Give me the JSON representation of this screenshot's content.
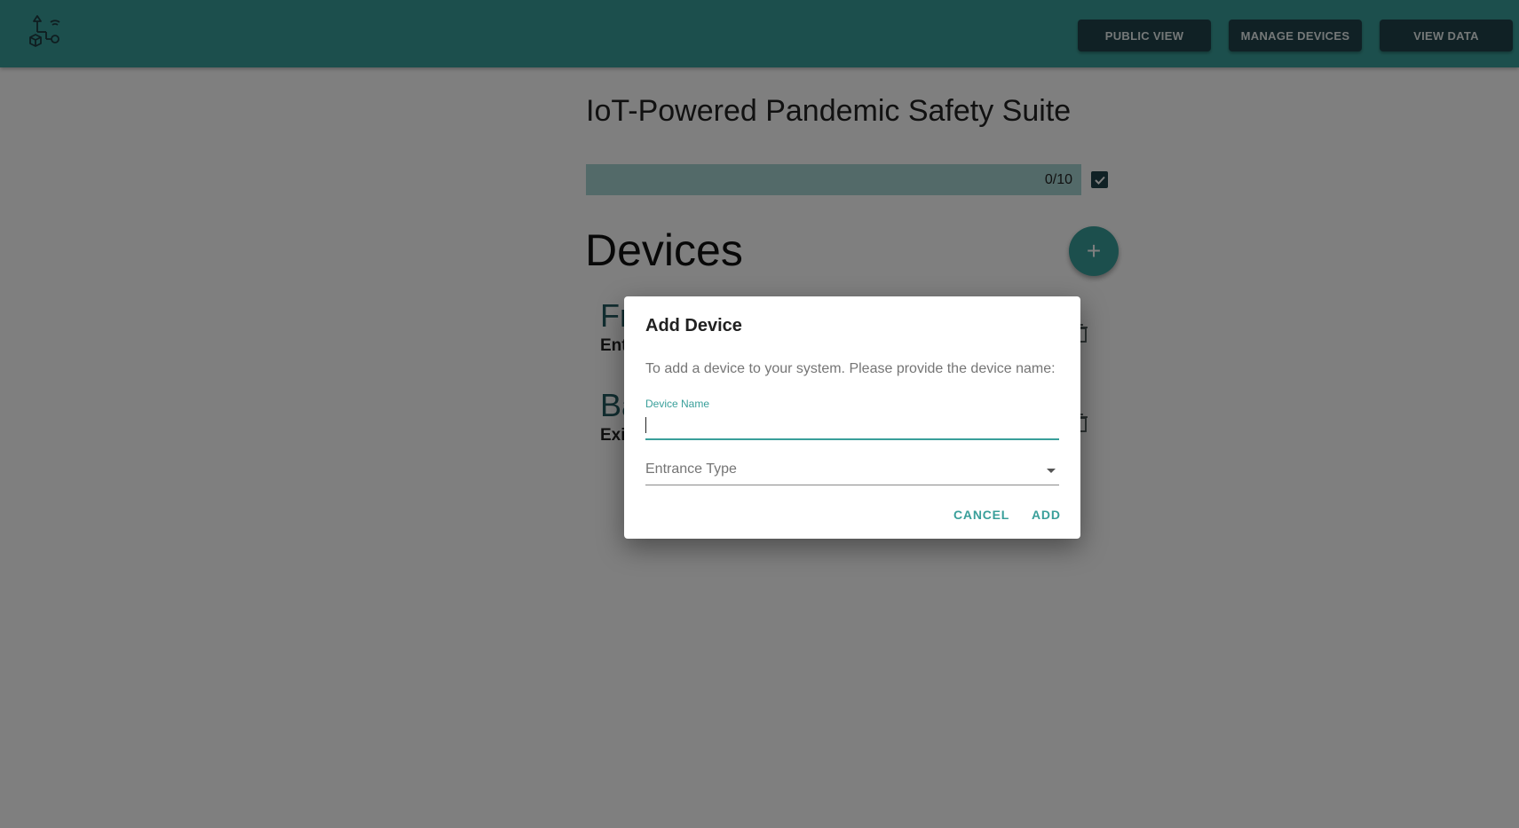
{
  "header": {
    "logo_icon": "iot-network-icon",
    "nav": [
      {
        "label": "PUBLIC VIEW"
      },
      {
        "label": "MANAGE DEVICES"
      },
      {
        "label": "VIEW DATA"
      }
    ]
  },
  "main": {
    "title": "IoT-Powered Pandemic Safety Suite",
    "progress": {
      "label": "0/10",
      "value": 0,
      "max": 10
    },
    "checkbox_checked": true,
    "section_title": "Devices",
    "add_button_icon": "plus-icon",
    "devices": [
      {
        "name": "Fr",
        "type": "Ent"
      },
      {
        "name": "Ba",
        "type": "Exi"
      }
    ]
  },
  "dialog": {
    "title": "Add Device",
    "text": "To add a device to your system. Please provide the device name:",
    "device_name_label": "Device Name",
    "device_name_value": "",
    "entrance_type_label": "Entrance Type",
    "cancel_label": "CANCEL",
    "add_label": "ADD"
  },
  "colors": {
    "primary": "#399f9a",
    "dark_button": "#20434b",
    "overlay": "rgba(0,0,0,0.5)"
  }
}
